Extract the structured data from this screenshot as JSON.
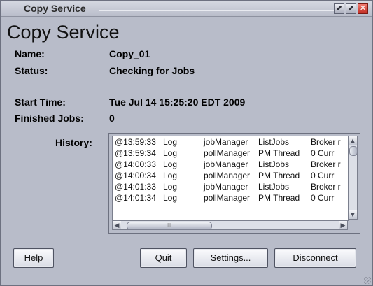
{
  "window": {
    "title": "Copy Service",
    "buttons": {
      "minimize": "⬋",
      "maximize": "⬈",
      "close": "✕"
    }
  },
  "heading": "Copy Service",
  "fields": {
    "name_label": "Name:",
    "name_value": "Copy_01",
    "status_label": "Status:",
    "status_value": "Checking for Jobs",
    "start_label": "Start Time:",
    "start_value": "Tue Jul 14 15:25:20 EDT 2009",
    "finished_label": "Finished Jobs:",
    "finished_value": "0"
  },
  "history": {
    "label": "History:",
    "rows": [
      {
        "time": "@13:59:33",
        "type": "Log",
        "source": "jobManager",
        "detail": "ListJobs",
        "message": "Broker r"
      },
      {
        "time": "@13:59:34",
        "type": "Log",
        "source": "pollManager",
        "detail": "PM Thread",
        "message": "0 Curr"
      },
      {
        "time": "@14:00:33",
        "type": "Log",
        "source": "jobManager",
        "detail": "ListJobs",
        "message": "Broker r"
      },
      {
        "time": "@14:00:34",
        "type": "Log",
        "source": "pollManager",
        "detail": "PM Thread",
        "message": "0 Curr"
      },
      {
        "time": "@14:01:33",
        "type": "Log",
        "source": "jobManager",
        "detail": "ListJobs",
        "message": "Broker r"
      },
      {
        "time": "@14:01:34",
        "type": "Log",
        "source": "pollManager",
        "detail": "PM Thread",
        "message": "0 Curr"
      }
    ],
    "vertical_scroll_position": 0.1,
    "horizontal_scroll_position": 0.0
  },
  "buttons": {
    "help": "Help",
    "quit": "Quit",
    "settings": "Settings...",
    "disconnect": "Disconnect"
  },
  "colors": {
    "background": "#b8bcc9",
    "close_button": "#c12c22"
  }
}
